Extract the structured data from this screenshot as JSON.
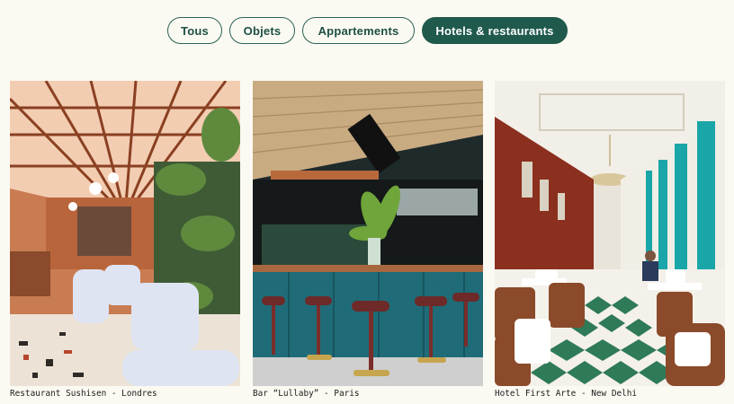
{
  "filters": {
    "tabs": [
      {
        "label": "Tous"
      },
      {
        "label": "Objets"
      },
      {
        "label": "Appartements"
      },
      {
        "label": "Hotels & restaurants",
        "active": true
      }
    ]
  },
  "gallery": {
    "items": [
      {
        "caption": "Restaurant Sushisen - Londres",
        "image": "greenhouse-restaurant-interior"
      },
      {
        "caption": "Bar “Lullaby” - Paris",
        "image": "teal-bar-with-stools"
      },
      {
        "caption": "Hotel First Arte - New Delhi",
        "image": "hotel-dining-hall-checkered-floor"
      }
    ]
  },
  "colors": {
    "accent": "#1f5a4c",
    "background": "#fbfaf2"
  }
}
